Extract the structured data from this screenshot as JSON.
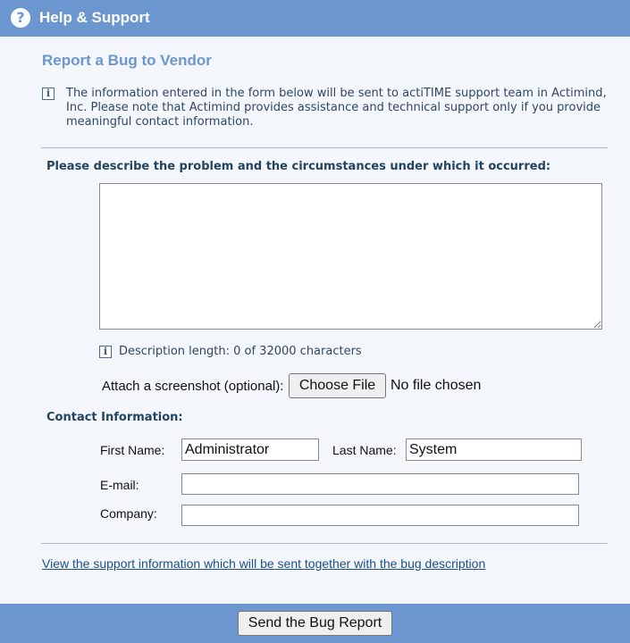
{
  "header": {
    "title": "Help & Support",
    "icon": "help-circle-icon",
    "icon_glyph": "?"
  },
  "page": {
    "title": "Report a Bug to Vendor"
  },
  "notice": {
    "icon": "info-icon",
    "icon_glyph": "i",
    "text": "The information entered in the form below will be sent to actiTIME support team in Actimind, Inc. Please note that Actimind provides assistance and technical support only if you provide meaningful contact information."
  },
  "description": {
    "label": "Please describe the problem and the circumstances under which it occurred:",
    "value": "",
    "length_text": "Description length: 0 of 32000 characters"
  },
  "attachment": {
    "label": "Attach a screenshot (optional):",
    "button_label": "Choose File",
    "status": "No file chosen"
  },
  "contact": {
    "heading": "Contact Information:",
    "first_name_label": "First Name:",
    "first_name_value": "Administrator",
    "last_name_label": "Last Name:",
    "last_name_value": "System",
    "email_label": "E-mail:",
    "email_value": "",
    "company_label": "Company:",
    "company_value": ""
  },
  "support_link": "View the support information which will be sent together with the bug description",
  "footer": {
    "send_label": "Send the Bug Report"
  },
  "colors": {
    "header_bg": "#6b96cf",
    "page_bg": "#f3f7fb",
    "title": "#6b96cf",
    "link": "#1d4f86"
  }
}
